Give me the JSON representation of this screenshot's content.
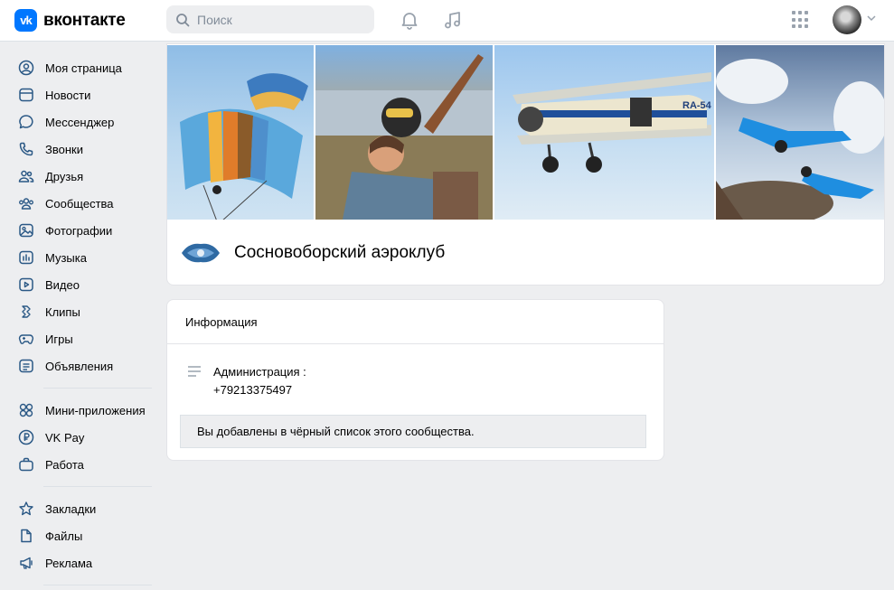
{
  "header": {
    "logo_mark": "vk",
    "logo_text": "вконтакте",
    "search_placeholder": "Поиск",
    "icons": [
      "search-icon",
      "bell-icon",
      "music-icon",
      "apps-grid-icon",
      "chevron-down-icon"
    ]
  },
  "sidebar": {
    "groups": [
      [
        {
          "label": "Моя страница",
          "icon": "user-circle-icon"
        },
        {
          "label": "Новости",
          "icon": "news-icon"
        },
        {
          "label": "Мессенджер",
          "icon": "message-icon"
        },
        {
          "label": "Звонки",
          "icon": "phone-icon"
        },
        {
          "label": "Друзья",
          "icon": "friends-icon"
        },
        {
          "label": "Сообщества",
          "icon": "communities-icon"
        },
        {
          "label": "Фотографии",
          "icon": "photo-icon"
        },
        {
          "label": "Музыка",
          "icon": "music-bars-icon"
        },
        {
          "label": "Видео",
          "icon": "video-icon"
        },
        {
          "label": "Клипы",
          "icon": "clips-icon"
        },
        {
          "label": "Игры",
          "icon": "gamepad-icon"
        },
        {
          "label": "Объявления",
          "icon": "ads-list-icon"
        }
      ],
      [
        {
          "label": "Мини-приложения",
          "icon": "mini-apps-icon"
        },
        {
          "label": "VK Pay",
          "icon": "vkpay-icon"
        },
        {
          "label": "Работа",
          "icon": "briefcase-icon"
        }
      ],
      [
        {
          "label": "Закладки",
          "icon": "star-icon"
        },
        {
          "label": "Файлы",
          "icon": "file-icon"
        },
        {
          "label": "Реклама",
          "icon": "megaphone-icon"
        }
      ]
    ]
  },
  "group": {
    "name": "Сосновоборский аэроклуб"
  },
  "info": {
    "title": "Информация",
    "admin_label": "Администрация :",
    "admin_phone": "+79213375497",
    "blacklist_notice": "Вы добавлены в чёрный список этого сообщества."
  },
  "colors": {
    "accent": "#0077ff",
    "background": "#edeef0",
    "icon": "#2a5885"
  }
}
